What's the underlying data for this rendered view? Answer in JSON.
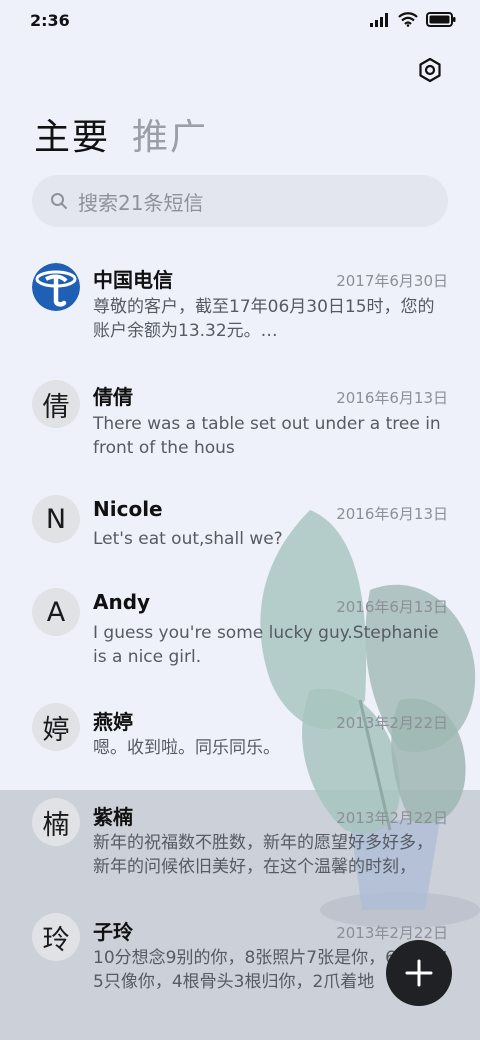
{
  "status_bar": {
    "time": "2:36"
  },
  "tabs": [
    {
      "label": "主要"
    },
    {
      "label": "推广"
    }
  ],
  "search": {
    "placeholder": "搜索21条短信"
  },
  "messages": [
    {
      "avatar": "",
      "sender": "中国电信",
      "date": "2017年6月30日",
      "preview": "尊敬的客户，截至17年06月30日15时，您的账户余额为13.32元。…"
    },
    {
      "avatar": "倩",
      "sender": "倩倩",
      "date": "2016年6月13日",
      "preview": "There was a table set out under a tree in front of the hous"
    },
    {
      "avatar": "N",
      "sender": "Nicole",
      "date": "2016年6月13日",
      "preview": "Let's eat out,shall we?"
    },
    {
      "avatar": "A",
      "sender": "Andy",
      "date": "2016年6月13日",
      "preview": "I guess you're some lucky guy.Stephanie is a nice girl."
    },
    {
      "avatar": "婷",
      "sender": "燕婷",
      "date": "2013年2月22日",
      "preview": "嗯。收到啦。同乐同乐。"
    },
    {
      "avatar": "楠",
      "sender": "紫楠",
      "date": "2013年2月22日",
      "preview": "新年的祝福数不胜数，新年的愿望好多好多，新年的问候依旧美好，在这个温馨的时刻，"
    },
    {
      "avatar": "玲",
      "sender": "子玲",
      "date": "2013年2月22日",
      "preview": "10分想念9别的你，8张照片7张是你，6只小狗5只像你，4根骨头3根归你，2爪着地"
    }
  ],
  "icons": {
    "settings": "settings-gear-icon",
    "search": "search-icon",
    "fab": "plus-icon",
    "signal": "signal-icon",
    "wifi": "wifi-icon",
    "battery": "battery-icon"
  },
  "colors": {
    "background": "#eef1fa",
    "fab": "#202124",
    "telecom_blue": "#1f5fb4"
  }
}
